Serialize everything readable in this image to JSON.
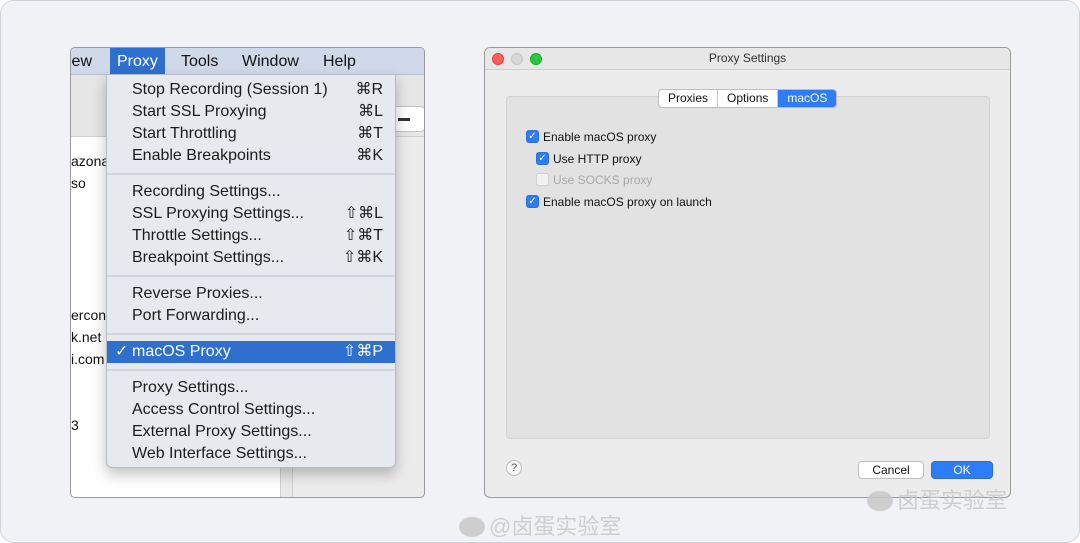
{
  "left": {
    "menubar": [
      "iew",
      "Proxy",
      "Tools",
      "Window",
      "Help"
    ],
    "active_menu": "Proxy",
    "hosts": [
      "azona",
      "so",
      "ercon",
      "k.net",
      "i.com",
      "3"
    ],
    "menu_groups": [
      [
        {
          "label": "Stop Recording (Session 1)",
          "shortcut": "⌘R"
        },
        {
          "label": "Start SSL Proxying",
          "shortcut": "⌘L"
        },
        {
          "label": "Start Throttling",
          "shortcut": "⌘T"
        },
        {
          "label": "Enable Breakpoints",
          "shortcut": "⌘K"
        }
      ],
      [
        {
          "label": "Recording Settings...",
          "shortcut": ""
        },
        {
          "label": "SSL Proxying Settings...",
          "shortcut": "⇧⌘L"
        },
        {
          "label": "Throttle Settings...",
          "shortcut": "⇧⌘T"
        },
        {
          "label": "Breakpoint Settings...",
          "shortcut": "⇧⌘K"
        }
      ],
      [
        {
          "label": "Reverse Proxies...",
          "shortcut": ""
        },
        {
          "label": "Port Forwarding...",
          "shortcut": ""
        }
      ],
      [
        {
          "label": "macOS Proxy",
          "shortcut": "⇧⌘P",
          "checked": "✓",
          "selected": true
        }
      ],
      [
        {
          "label": "Proxy Settings...",
          "shortcut": ""
        },
        {
          "label": "Access Control Settings...",
          "shortcut": ""
        },
        {
          "label": "External Proxy Settings...",
          "shortcut": ""
        },
        {
          "label": "Web Interface Settings...",
          "shortcut": ""
        }
      ]
    ]
  },
  "right": {
    "title": "Proxy Settings",
    "tabs": [
      {
        "label": "Proxies"
      },
      {
        "label": "Options"
      },
      {
        "label": "macOS",
        "active": true
      }
    ],
    "options": [
      {
        "label": "Enable macOS proxy",
        "checked": true,
        "enabled": true,
        "indent": 0
      },
      {
        "label": "Use HTTP proxy",
        "checked": true,
        "enabled": true,
        "indent": 1
      },
      {
        "label": "Use SOCKS proxy",
        "checked": false,
        "enabled": false,
        "indent": 1
      },
      {
        "label": "Enable macOS proxy on launch",
        "checked": true,
        "enabled": true,
        "indent": 0
      }
    ],
    "help": "?",
    "cancel_label": "Cancel",
    "ok_label": "OK"
  },
  "watermarks": [
    "@卤蛋实验室",
    "卤蛋实验室"
  ],
  "colors": {
    "menu_highlight": "#2f6fce",
    "accent_blue": "#2f7df6"
  }
}
